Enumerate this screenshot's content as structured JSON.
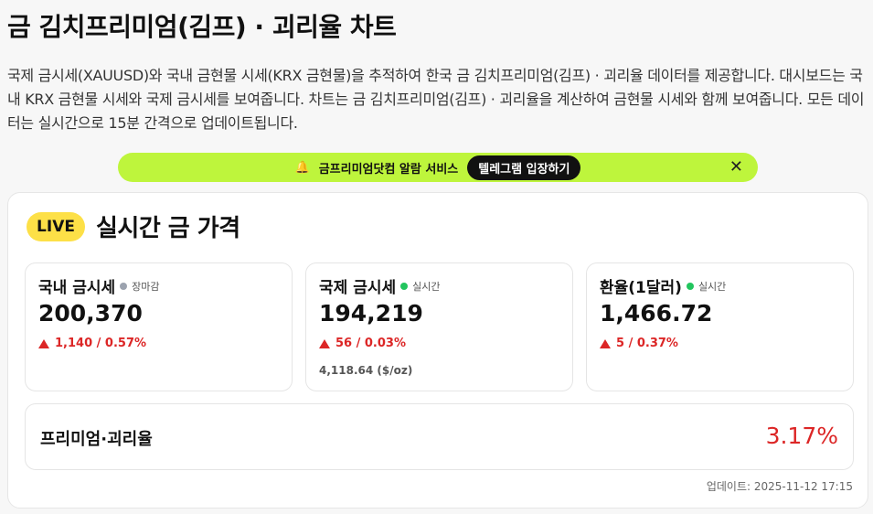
{
  "page": {
    "title": "금 김치프리미엄(김프) · 괴리율 차트",
    "intro": "국제 금시세(XAUUSD)와 국내 금현물 시세(KRX 금현물)을 추적하여 한국 금 김치프리미엄(김프) · 괴리율 데이터를 제공합니다. 대시보드는 국내 KRX 금현물 시세와 국제 금시세를 보여줍니다. 차트는 금 김치프리미엄(김프) · 괴리율을 계산하여 금현물 시세와 함께 보여줍니다. 모든 데이터는 실시간으로 15분 간격으로 업데이트됩니다."
  },
  "promo": {
    "text": "금프리미엄닷컴 알람 서비스",
    "button": "텔레그램 입장하기",
    "close": "✕",
    "bell_icon": "🔔"
  },
  "live": {
    "badge": "LIVE",
    "title": "실시간 금 가격"
  },
  "prices": [
    {
      "label": "국내 금시세",
      "status": "장마감",
      "status_color": "#9ca3af",
      "value": "200,370",
      "change": "1,140 / 0.57%",
      "sub": ""
    },
    {
      "label": "국제 금시세",
      "status": "실시간",
      "status_color": "#22c55e",
      "value": "194,219",
      "change": "56 / 0.03%",
      "sub": "4,118.64 ($/oz)"
    },
    {
      "label": "환율(1달러)",
      "status": "실시간",
      "status_color": "#22c55e",
      "value": "1,466.72",
      "change": "5 / 0.37%",
      "sub": ""
    }
  ],
  "premium": {
    "label": "프리미엄·괴리율",
    "value": "3.17%"
  },
  "updated": "업데이트: 2025-11-12 17:15",
  "colors": {
    "up": "#dc2626",
    "promo_bg": "#bef53c",
    "live_badge": "#fde047"
  }
}
